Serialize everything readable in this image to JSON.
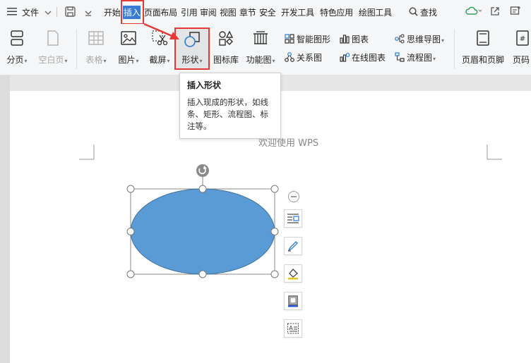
{
  "menu": {
    "file_label": "文件",
    "tabs": [
      "开始",
      "插入",
      "页面布局",
      "引用",
      "审阅",
      "视图",
      "章节",
      "安全",
      "开发工具",
      "特色应用",
      "绘图工具"
    ],
    "search_label": "查找"
  },
  "ribbon": {
    "page_break": "分页",
    "blank_page": "空白页",
    "table": "表格",
    "picture": "图片",
    "screenshot": "截屏",
    "shape": "形状",
    "icon_library": "图标库",
    "function_chart": "功能图",
    "smart_graphic": "智能图形",
    "chart": "图表",
    "relation_chart": "关系图",
    "online_chart": "在线图表",
    "mind_map": "思维导图",
    "flowchart": "流程图",
    "header_footer": "页眉和页脚",
    "page_number": "页码"
  },
  "tooltip": {
    "title": "插入形状",
    "body": "插入现成的形状，如线条、矩形、流程图、标注等。"
  },
  "document": {
    "welcome_text": "欢迎使用 WPS"
  },
  "colors": {
    "accent": "#3a7bd5",
    "highlight": "#e53935",
    "shape_fill": "#5b9bd5"
  }
}
